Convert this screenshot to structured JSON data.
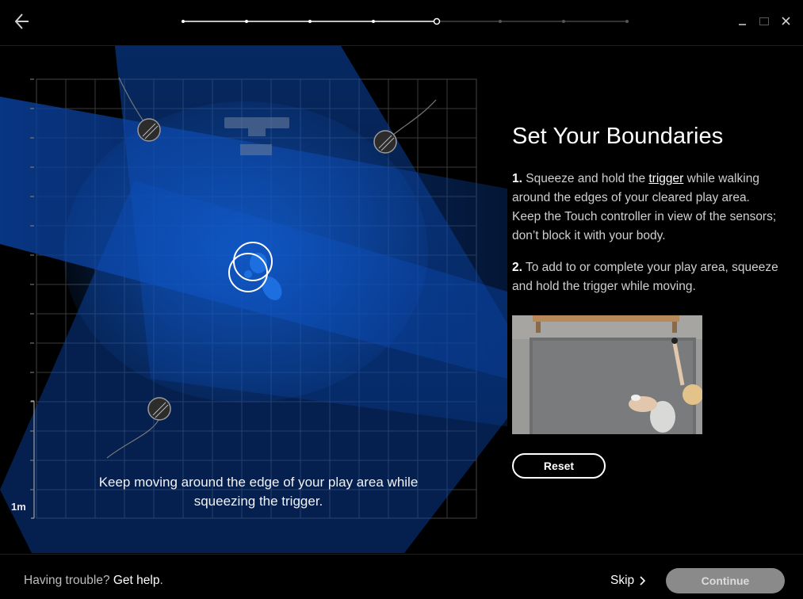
{
  "header": {
    "back_icon": "arrow-left-icon",
    "progress": {
      "total_steps": 8,
      "current_step": 5
    },
    "window_controls": [
      "minimize-icon",
      "maximize-icon",
      "close-icon"
    ]
  },
  "play_area": {
    "scale_label": "1m",
    "hint": "Keep moving around the edge of your play area while squeezing the trigger.",
    "colors": {
      "grid": "#3a3a3a",
      "sensor_beam": "#0a4bb0",
      "tracker": "#1d6fe0"
    }
  },
  "panel": {
    "title": "Set Your Boundaries",
    "step1": {
      "num": "1.",
      "text_before": " Squeeze and hold the ",
      "link": "trigger",
      "text_after": " while walking around the edges of your cleared play area. Keep the Touch controller in view of the sensors; don’t block it with your body."
    },
    "step2": {
      "num": "2.",
      "text": " To add to or complete your play area, squeeze and hold the trigger while moving."
    },
    "reset_label": "Reset"
  },
  "footer": {
    "trouble_text": "Having trouble? ",
    "help_link": "Get help",
    "help_period": ".",
    "skip_label": "Skip",
    "continue_label": "Continue"
  }
}
